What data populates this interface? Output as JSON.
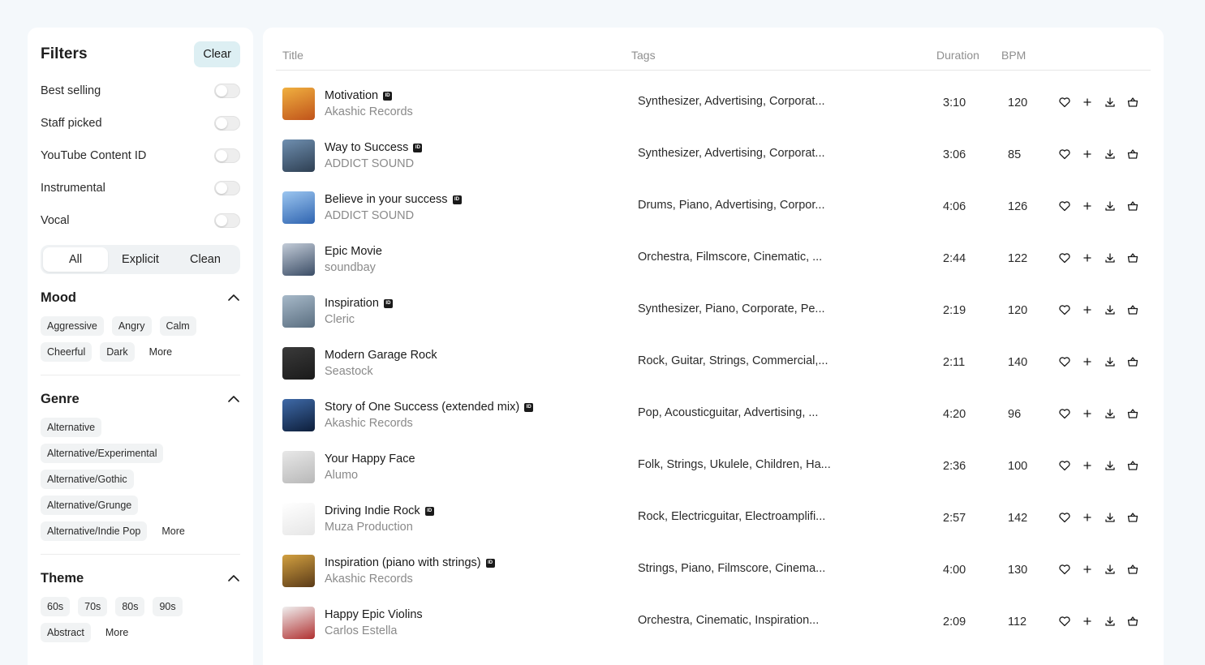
{
  "filters": {
    "title": "Filters",
    "clear_label": "Clear",
    "toggles": [
      {
        "label": "Best selling",
        "on": false
      },
      {
        "label": "Staff picked",
        "on": false
      },
      {
        "label": "YouTube Content ID",
        "on": false
      },
      {
        "label": "Instrumental",
        "on": false
      },
      {
        "label": "Vocal",
        "on": false
      }
    ],
    "content_segments": [
      {
        "label": "All",
        "active": true
      },
      {
        "label": "Explicit",
        "active": false
      },
      {
        "label": "Clean",
        "active": false
      }
    ]
  },
  "mood": {
    "title": "Mood",
    "icon": "chevron-up-icon",
    "chips": [
      "Aggressive",
      "Angry",
      "Calm",
      "Cheerful",
      "Dark"
    ],
    "more_label": "More"
  },
  "genre": {
    "title": "Genre",
    "icon": "chevron-up-icon",
    "chips": [
      "Alternative",
      "Alternative/Experimental",
      "Alternative/Gothic",
      "Alternative/Grunge",
      "Alternative/Indie Pop"
    ],
    "more_label": "More"
  },
  "theme": {
    "title": "Theme",
    "icon": "chevron-up-icon",
    "chips": [
      "60s",
      "70s",
      "80s",
      "90s",
      "Abstract"
    ],
    "more_label": "More"
  },
  "table": {
    "headers": {
      "title": "Title",
      "tags": "Tags",
      "duration": "Duration",
      "bpm": "BPM"
    },
    "row_action_icons": [
      "heart-icon",
      "plus-icon",
      "download-icon",
      "basket-icon"
    ],
    "tracks": [
      {
        "title": "Motivation",
        "content_id": true,
        "artist": "Akashic Records",
        "tags": "Synthesizer, Advertising, Corporat...",
        "duration": "3:10",
        "bpm": "120",
        "thumb_colors": [
          "#f0b040",
          "#c0531a"
        ]
      },
      {
        "title": "Way to Success",
        "content_id": true,
        "artist": "ADDICT SOUND",
        "tags": "Synthesizer, Advertising, Corporat...",
        "duration": "3:06",
        "bpm": "85",
        "thumb_colors": [
          "#6f8fb0",
          "#2e3f52"
        ]
      },
      {
        "title": "Believe in your success",
        "content_id": true,
        "artist": "ADDICT SOUND",
        "tags": "Drums, Piano, Advertising, Corpor...",
        "duration": "4:06",
        "bpm": "126",
        "thumb_colors": [
          "#9cc6f0",
          "#2f64b0"
        ]
      },
      {
        "title": "Epic Movie",
        "content_id": false,
        "artist": "soundbay",
        "tags": "Orchestra, Filmscore, Cinematic, ...",
        "duration": "2:44",
        "bpm": "122",
        "thumb_colors": [
          "#c3ccd8",
          "#3b4d66"
        ]
      },
      {
        "title": "Inspiration",
        "content_id": true,
        "artist": "Cleric",
        "tags": "Synthesizer, Piano, Corporate, Pe...",
        "duration": "2:19",
        "bpm": "120",
        "thumb_colors": [
          "#a7b9c9",
          "#5a6e80"
        ]
      },
      {
        "title": "Modern Garage Rock",
        "content_id": false,
        "artist": "Seastock",
        "tags": "Rock, Guitar, Strings, Commercial,...",
        "duration": "2:11",
        "bpm": "140",
        "thumb_colors": [
          "#3a3a3a",
          "#1a1a1a"
        ]
      },
      {
        "title": "Story of One Success (extended mix)",
        "content_id": true,
        "artist": "Akashic Records",
        "tags": "Pop, Acousticguitar, Advertising, ...",
        "duration": "4:20",
        "bpm": "96",
        "thumb_colors": [
          "#3f6aa8",
          "#0d1e3a"
        ]
      },
      {
        "title": "Your Happy Face",
        "content_id": false,
        "artist": "Alumo",
        "tags": "Folk, Strings, Ukulele, Children, Ha...",
        "duration": "2:36",
        "bpm": "100",
        "thumb_colors": [
          "#e8e8e8",
          "#b8b8b8"
        ]
      },
      {
        "title": "Driving Indie Rock",
        "content_id": true,
        "artist": "Muza Production",
        "tags": "Rock, Electricguitar, Electroamplifi...",
        "duration": "2:57",
        "bpm": "142",
        "thumb_colors": [
          "#ffffff",
          "#e6e6e6"
        ]
      },
      {
        "title": "Inspiration (piano with strings)",
        "content_id": true,
        "artist": "Akashic Records",
        "tags": "Strings, Piano, Filmscore, Cinema...",
        "duration": "4:00",
        "bpm": "130",
        "thumb_colors": [
          "#d2a040",
          "#5a3a18"
        ]
      },
      {
        "title": "Happy Epic Violins",
        "content_id": false,
        "artist": "Carlos Estella",
        "tags": "Orchestra, Cinematic, Inspiration...",
        "duration": "2:09",
        "bpm": "112",
        "thumb_colors": [
          "#f0f0f0",
          "#b03030"
        ]
      }
    ]
  }
}
